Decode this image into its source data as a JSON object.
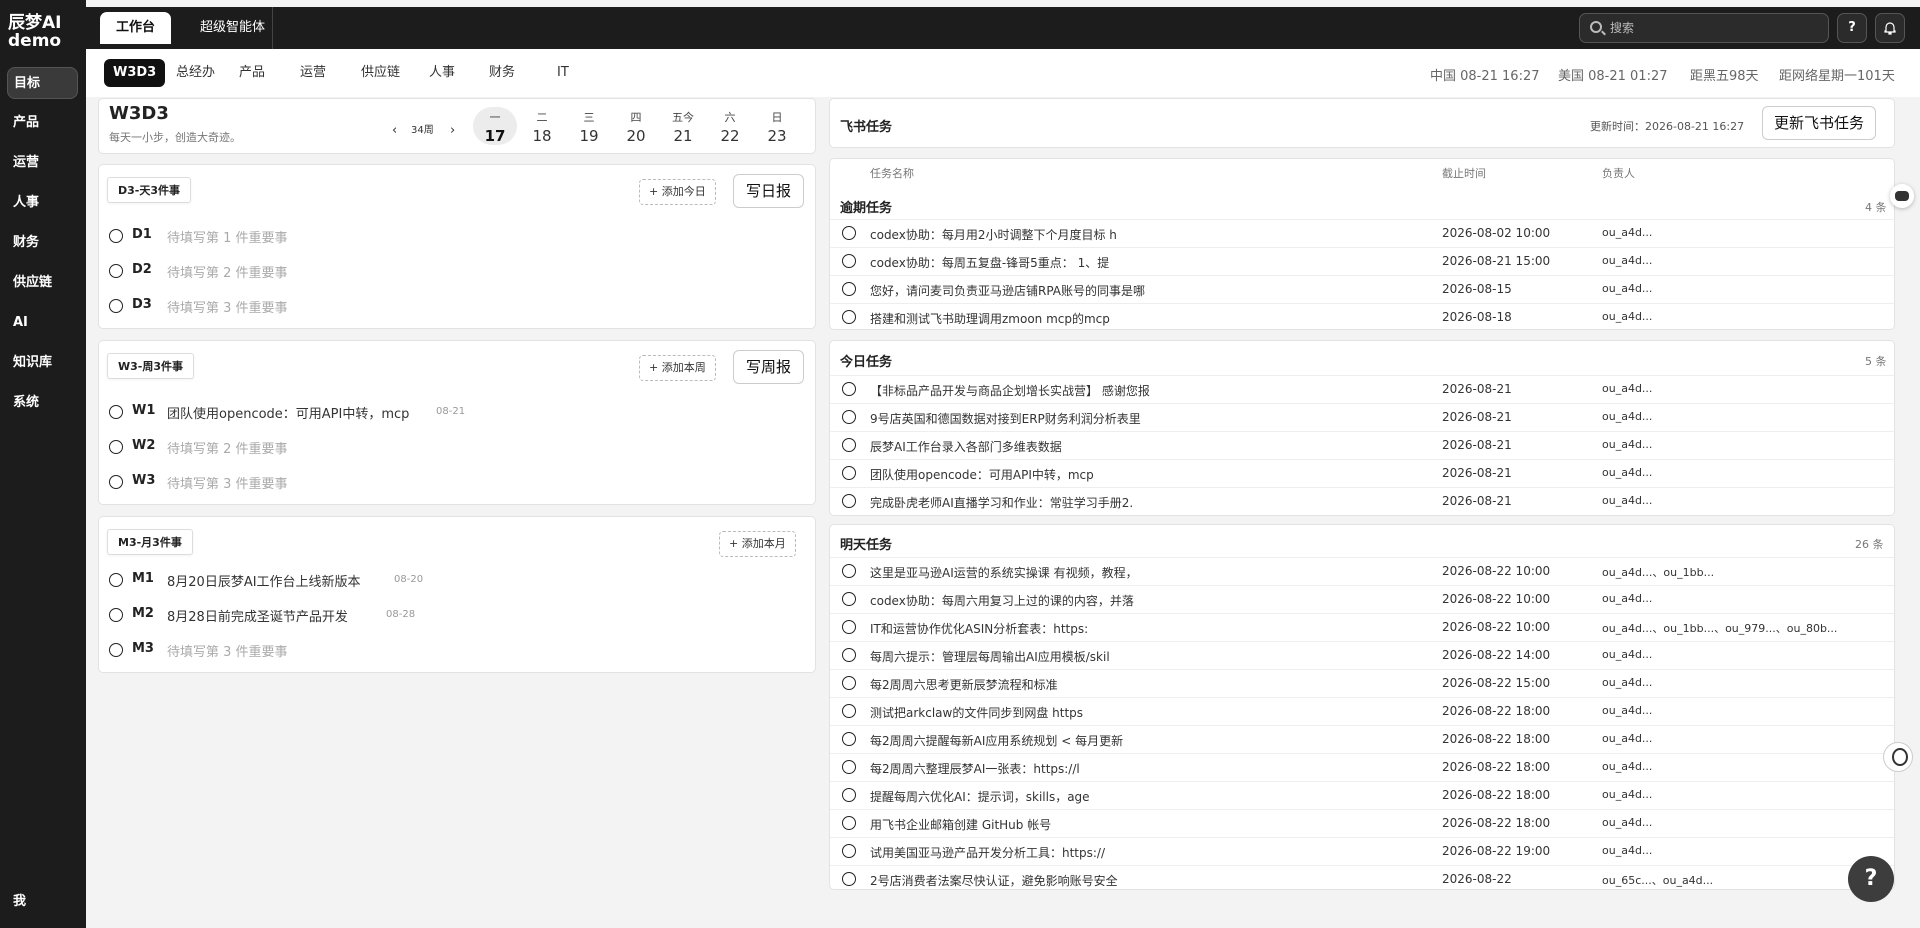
{
  "app": {
    "logo": "辰梦AI demo",
    "me": "我"
  },
  "sidebar": {
    "items": [
      {
        "label": "目标"
      },
      {
        "label": "产品"
      },
      {
        "label": "运营"
      },
      {
        "label": "人事"
      },
      {
        "label": "财务"
      },
      {
        "label": "供应链"
      },
      {
        "label": "AI"
      },
      {
        "label": "知识库"
      },
      {
        "label": "系统"
      }
    ]
  },
  "topbar": {
    "tabs": [
      {
        "label": "工作台"
      },
      {
        "label": "超级智能体"
      }
    ],
    "search_placeholder": "搜索",
    "help_label": "?"
  },
  "subnav": {
    "tabs": [
      {
        "label": "W3D3"
      },
      {
        "label": "总经办"
      },
      {
        "label": "产品"
      },
      {
        "label": "运营"
      },
      {
        "label": "供应链"
      },
      {
        "label": "人事"
      },
      {
        "label": "财务"
      },
      {
        "label": "IT"
      }
    ],
    "clocks": [
      "中国 08-21 16:27",
      "美国 08-21 01:27",
      "距黑五98天",
      "距网络星期一101天"
    ]
  },
  "w3d3": {
    "title": "W3D3",
    "subtitle": "每天一小步，创造大奇迹。",
    "week_label": "34周",
    "prev": "‹",
    "next": "›",
    "days": [
      {
        "name": "一",
        "date": "17"
      },
      {
        "name": "二",
        "date": "18"
      },
      {
        "name": "三",
        "date": "19"
      },
      {
        "name": "四",
        "date": "20"
      },
      {
        "name": "五今",
        "date": "21"
      },
      {
        "name": "六",
        "date": "22"
      },
      {
        "name": "日",
        "date": "23"
      }
    ]
  },
  "d3": {
    "label": "D3-天3件事",
    "add": "+ 添加今日",
    "write": "写日报",
    "items": [
      {
        "code": "D1",
        "text": "待填写第 1 件重要事",
        "date": ""
      },
      {
        "code": "D2",
        "text": "待填写第 2 件重要事",
        "date": ""
      },
      {
        "code": "D3",
        "text": "待填写第 3 件重要事",
        "date": ""
      }
    ]
  },
  "w3": {
    "label": "W3-周3件事",
    "add": "+ 添加本周",
    "write": "写周报",
    "items": [
      {
        "code": "W1",
        "text": "团队使用opencode：可用API中转，mcp",
        "date": "08-21"
      },
      {
        "code": "W2",
        "text": "待填写第 2 件重要事",
        "date": ""
      },
      {
        "code": "W3",
        "text": "待填写第 3 件重要事",
        "date": ""
      }
    ]
  },
  "m3": {
    "label": "M3-月3件事",
    "add": "+ 添加本月",
    "items": [
      {
        "code": "M1",
        "text": "8月20日辰梦AI工作台上线新版本",
        "date": "08-20"
      },
      {
        "code": "M2",
        "text": "8月28日前完成圣诞节产品开发",
        "date": "08-28"
      },
      {
        "code": "M3",
        "text": "待填写第 3 件重要事",
        "date": ""
      }
    ]
  },
  "feishu": {
    "title": "飞书任务",
    "update_text": "更新时间：2026-08-21 16:27",
    "update_btn": "更新飞书任务",
    "headers": {
      "name": "任务名称",
      "due": "截止时间",
      "owner": "负责人"
    },
    "overdue": {
      "title": "逾期任务",
      "count": "4 条",
      "rows": [
        {
          "name": "codex协助：每月用2小时调整下个月度目标 h",
          "due": "2026-08-02 10:00",
          "owner": "ou_a4d..."
        },
        {
          "name": "codex协助：每周五复盘-锋哥5重点： 1、提",
          "due": "2026-08-21 15:00",
          "owner": "ou_a4d..."
        },
        {
          "name": "您好，请问麦司负责亚马逊店铺RPA账号的同事是哪",
          "due": "2026-08-15",
          "owner": "ou_a4d..."
        },
        {
          "name": "搭建和测试飞书助理调用zmoon mcp的mcp",
          "due": "2026-08-18",
          "owner": "ou_a4d..."
        }
      ]
    },
    "today": {
      "title": "今日任务",
      "count": "5 条",
      "rows": [
        {
          "name": "【非标品产品开发与商品企划增长实战营】 感谢您报",
          "due": "2026-08-21",
          "owner": "ou_a4d..."
        },
        {
          "name": "9号店英国和德国数据对接到ERP财务利润分析表里",
          "due": "2026-08-21",
          "owner": "ou_a4d..."
        },
        {
          "name": "辰梦AI工作台录入各部门多维表数据",
          "due": "2026-08-21",
          "owner": "ou_a4d..."
        },
        {
          "name": "团队使用opencode：可用API中转，mcp",
          "due": "2026-08-21",
          "owner": "ou_a4d..."
        },
        {
          "name": "完成卧虎老师AI直播学习和作业：常驻学习手册2.",
          "due": "2026-08-21",
          "owner": "ou_a4d..."
        }
      ]
    },
    "tomorrow": {
      "title": "明天任务",
      "count": "26 条",
      "rows": [
        {
          "name": "这里是亚马逊AI运营的系统实操课 有视频，教程，",
          "due": "2026-08-22 10:00",
          "owner": "ou_a4d...、ou_1bb..."
        },
        {
          "name": "codex协助：每周六用复习上过的课的内容，并落",
          "due": "2026-08-22 10:00",
          "owner": "ou_a4d..."
        },
        {
          "name": "IT和运营协作优化ASIN分析套表：https:",
          "due": "2026-08-22 10:00",
          "owner": "ou_a4d...、ou_1bb...、ou_979...、ou_80b..."
        },
        {
          "name": "每周六提示：管理层每周输出AI应用模板/skil",
          "due": "2026-08-22 14:00",
          "owner": "ou_a4d..."
        },
        {
          "name": "每2周周六思考更新辰梦流程和标准",
          "due": "2026-08-22 15:00",
          "owner": "ou_a4d..."
        },
        {
          "name": "测试把arkclaw的文件同步到网盘 https",
          "due": "2026-08-22 18:00",
          "owner": "ou_a4d..."
        },
        {
          "name": "每2周周六提醒每新AI应用系统规划 < 每月更新",
          "due": "2026-08-22 18:00",
          "owner": "ou_a4d..."
        },
        {
          "name": "每2周周六整理辰梦AI一张表：https://l",
          "due": "2026-08-22 18:00",
          "owner": "ou_a4d..."
        },
        {
          "name": "提醒每周六优化AI：提示词，skills，age",
          "due": "2026-08-22 18:00",
          "owner": "ou_a4d..."
        },
        {
          "name": "用飞书企业邮箱创建 GitHub 帐号",
          "due": "2026-08-22 18:00",
          "owner": "ou_a4d..."
        },
        {
          "name": "试用美国亚马逊产品开发分析工具：https://",
          "due": "2026-08-22 19:00",
          "owner": "ou_a4d..."
        },
        {
          "name": "2号店消费者法案尽快认证，避免影响账号安全",
          "due": "2026-08-22",
          "owner": "ou_65c...、ou_a4d..."
        }
      ]
    },
    "fab": "?"
  }
}
